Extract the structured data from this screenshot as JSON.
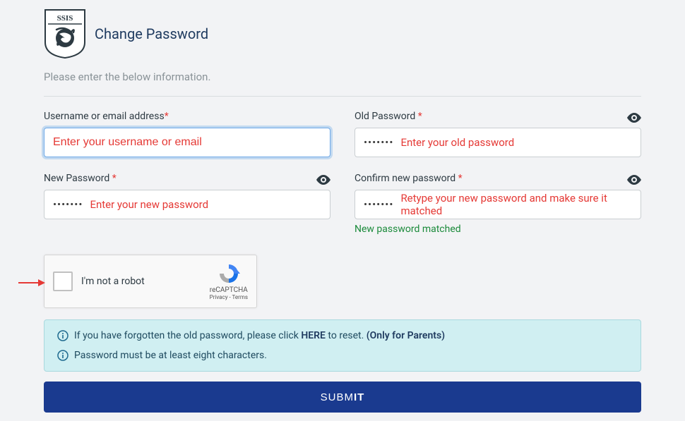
{
  "logo_text": "SSIS",
  "page_title": "Change Password",
  "subtitle": "Please enter the below information.",
  "fields": {
    "username": {
      "label": "Username or email address",
      "placeholder": "Enter your username or email"
    },
    "old_password": {
      "label": "Old Password",
      "placeholder": "Enter your old password",
      "masked_value": "•••••••"
    },
    "new_password": {
      "label": "New Password",
      "placeholder": "Enter your new password",
      "masked_value": "•••••••"
    },
    "confirm_password": {
      "label": "Confirm new password",
      "placeholder": "Retype your new password and make sure it matched",
      "masked_value": "•••••••",
      "validation": "New password matched"
    }
  },
  "recaptcha": {
    "label": "I'm not a robot",
    "brand": "reCAPTCHA",
    "privacy": "Privacy",
    "terms": "Terms"
  },
  "info": {
    "line1_prefix": "If you have forgotten the old password, please click ",
    "line1_here": "HERE",
    "line1_mid": " to reset. ",
    "line1_suffix": "(Only for Parents)",
    "line2": "Password must be at least eight characters."
  },
  "submit": {
    "prefix": "SUBM",
    "suffix": "IT"
  }
}
